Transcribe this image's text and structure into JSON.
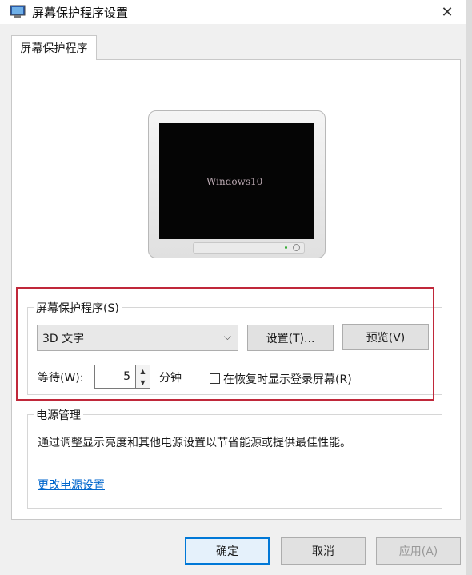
{
  "window": {
    "title": "屏幕保护程序设置",
    "close_glyph": "✕"
  },
  "tabs": [
    {
      "label": "屏幕保护程序",
      "selected": true
    }
  ],
  "preview": {
    "screen_text": "Windows10"
  },
  "screensaver": {
    "group_label": "屏幕保护程序(S)",
    "selected": "3D 文字",
    "settings_label": "设置(T)...",
    "preview_label": "预览(V)",
    "wait_label": "等待(W):",
    "wait_value": "5",
    "wait_unit": "分钟",
    "resume_logon_label": "在恢复时显示登录屏幕(R)",
    "resume_logon_checked": false
  },
  "power": {
    "group_label": "电源管理",
    "description": "通过调整显示亮度和其他电源设置以节省能源或提供最佳性能。",
    "link_label": "更改电源设置"
  },
  "footer": {
    "ok_label": "确定",
    "cancel_label": "取消",
    "apply_label": "应用(A)"
  },
  "colors": {
    "highlight": "#c0283a",
    "link": "#0066cc"
  }
}
